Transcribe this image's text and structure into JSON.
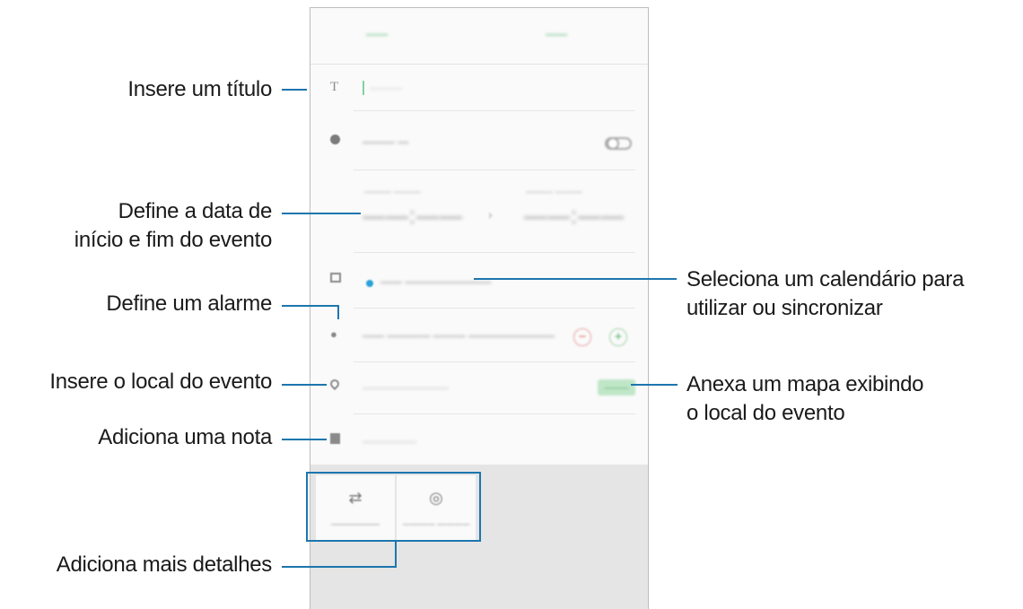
{
  "callouts": {
    "title": "Insere um título",
    "date_line1": "Define a data de",
    "date_line2": "início e fim do evento",
    "alarm": "Define um alarme",
    "location": "Insere o local do evento",
    "note": "Adiciona uma nota",
    "more": "Adiciona mais detalhes",
    "calendar_line1": "Seleciona um calendário para",
    "calendar_line2": "utilizar ou sincronizar",
    "map_line1": "Anexa um mapa exibindo",
    "map_line2": "o local do evento"
  },
  "colors": {
    "callout_line": "#1d76ae",
    "accent_green": "#6cc383",
    "calendar_dot": "#2aa2d6"
  }
}
